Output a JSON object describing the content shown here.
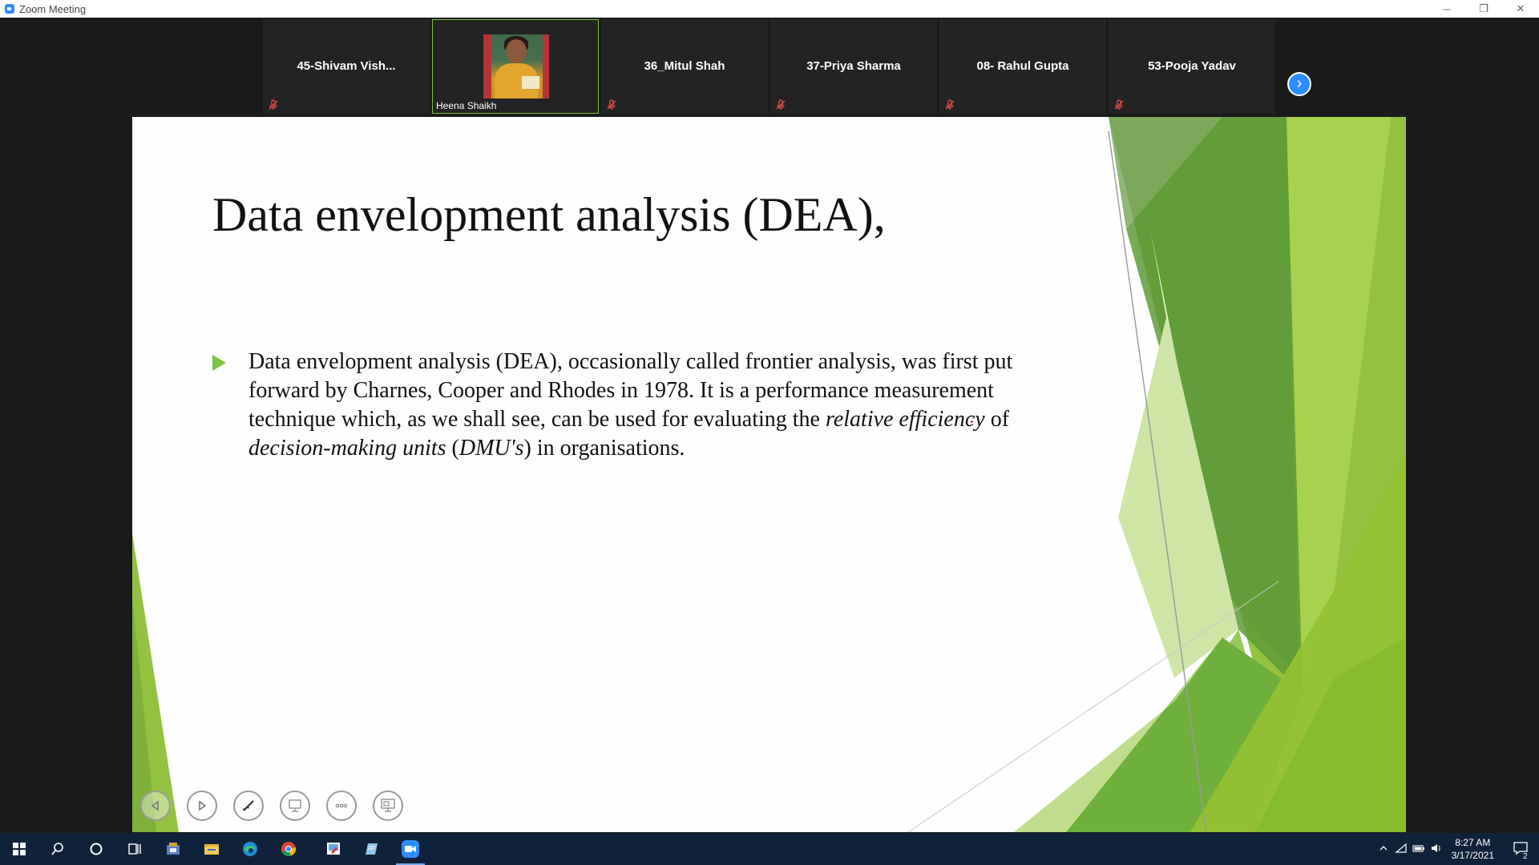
{
  "window": {
    "title": "Zoom Meeting",
    "controls": [
      "─",
      "❐",
      "✕"
    ]
  },
  "participants": [
    {
      "name": "45-Shivam  Vish...",
      "muted": true
    },
    {
      "name": "Heena Shaikh",
      "video": true,
      "active": true
    },
    {
      "name": "36_Mitul Shah",
      "muted": true
    },
    {
      "name": "37-Priya Sharma",
      "muted": true
    },
    {
      "name": "08- Rahul Gupta",
      "muted": true
    },
    {
      "name": "53-Pooja Yadav",
      "muted": true
    }
  ],
  "strip": {
    "next_icon": "›"
  },
  "slide": {
    "title": "Data envelopment analysis (DEA),",
    "bullet": {
      "t1": "Data envelopment analysis (DEA), occasionally called frontier analysis, was first put forward by Charnes, Cooper and Rhodes in 1978. It is a performance measurement technique which, as we shall see, can be used for evaluating the ",
      "t2": "relative efficiency",
      "t3": " of ",
      "t4": "decision-making units",
      "t5": " (",
      "t6": "DMU's",
      "t7": ") in organisations."
    },
    "accent_color": "#7dc33f"
  },
  "slide_controls": [
    "previous-icon",
    "next-icon",
    "pen-icon",
    "slides-icon",
    "more-icon",
    "presenter-view-icon"
  ],
  "taskbar": {
    "time": "8:27 AM",
    "date": "3/17/2021",
    "notifications": "2",
    "apps": [
      "start-icon",
      "search-icon",
      "cortana-icon",
      "task-view-icon",
      "app-icon",
      "file-explorer-icon",
      "edge-icon",
      "chrome-icon",
      "paint-icon",
      "notepad-icon",
      "zoom-icon"
    ]
  }
}
